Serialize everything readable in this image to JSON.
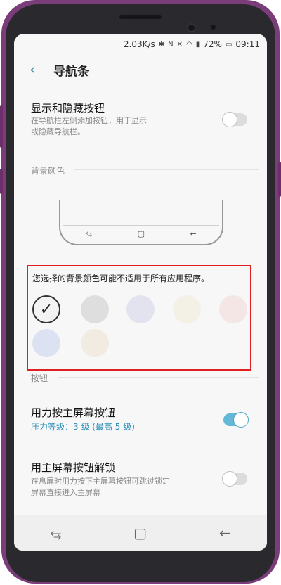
{
  "status_bar": {
    "speed": "2.03K/s",
    "battery": "72%",
    "time": "09:11"
  },
  "header": {
    "title": "导航条"
  },
  "show_hide": {
    "title": "显示和隐藏按钮",
    "subtitle_line1": "在导航栏左侧添加按钮，用于显示",
    "subtitle_line2": "或隐藏导航栏。"
  },
  "background": {
    "label": "背景颜色",
    "notice": "您选择的背景颜色可能不适用于所有应用程序。"
  },
  "swatches": [
    {
      "color": "#f3f3f3",
      "selected": true
    },
    {
      "color": "#dedede"
    },
    {
      "color": "#e3e3f0"
    },
    {
      "color": "#f3f0e6"
    },
    {
      "color": "#f5e6e6"
    },
    {
      "color": "#dde2f2"
    },
    {
      "color": "#f1ebe2"
    }
  ],
  "buttons": {
    "label": "按钮"
  },
  "press_home": {
    "title": "用力按主屏幕按钮",
    "subtitle": "压力等级：3 级 (最高 5 级)"
  },
  "unlock": {
    "title": "用主屏幕按钮解锁",
    "subtitle_line1": "在息屏时用力按下主屏幕按钮可跳过锁定",
    "subtitle_line2": "屏幕直接进入主屏幕"
  },
  "icons": {
    "back": "‹",
    "recent": "⥃",
    "home": "▢",
    "nav_back": "←"
  }
}
